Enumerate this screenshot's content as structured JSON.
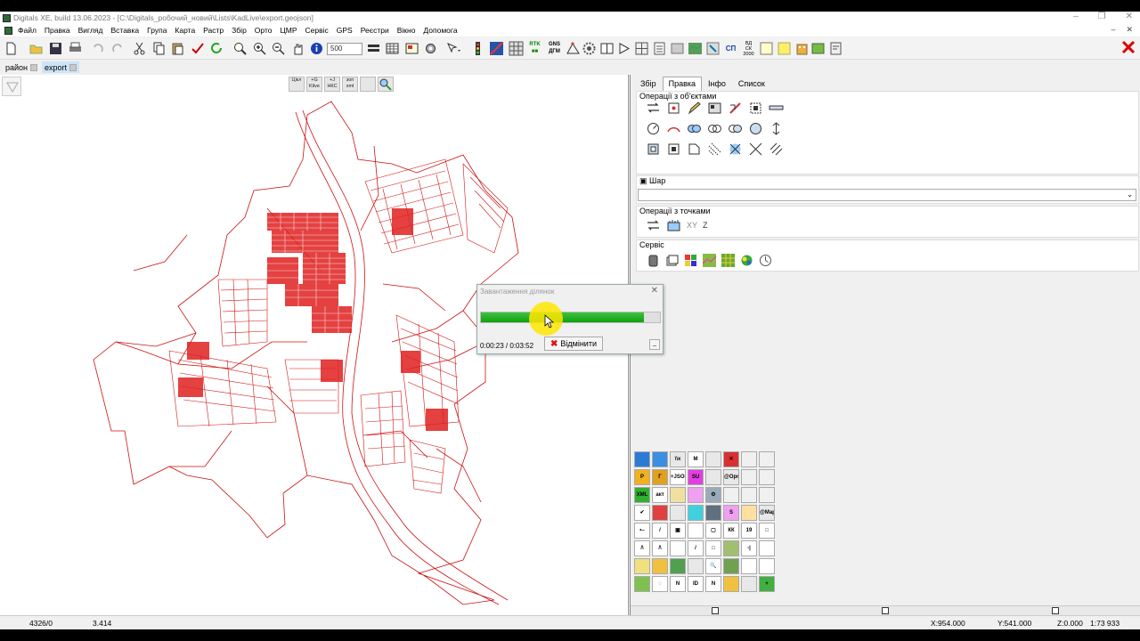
{
  "app": {
    "title": "Digitals XE, build 13.06.2023 - [C:\\Digitals_робочий_новий\\Lists\\KadLive\\export.geojson]"
  },
  "menu": [
    "Файл",
    "Правка",
    "Вигляд",
    "Вставка",
    "Група",
    "Карта",
    "Растр",
    "Збір",
    "Орто",
    "ЦМР",
    "Сервіс",
    "GPS",
    "Реєстри",
    "Вікно",
    "Допомога"
  ],
  "toolbar": {
    "scale_value": "500"
  },
  "doc_tabs": [
    "район",
    "export"
  ],
  "map_tools": [
    "Цікл",
    "+G Klive",
    "+J НКС",
    "зоп xml",
    "",
    ""
  ],
  "panel": {
    "tabs": [
      "Збір",
      "Правка",
      "Інфо",
      "Список"
    ],
    "active_tab": "Правка",
    "sections": {
      "objects": "Операції з об'єктами",
      "layer": "Шар",
      "points": "Операції з точками",
      "service": "Сервіс"
    },
    "points_labels": [
      "XY",
      "Z"
    ]
  },
  "palette": [
    {
      "label": "",
      "color": "#2b7bd6"
    },
    {
      "label": "",
      "color": "#3a8fe0"
    },
    {
      "label": "\\\\x",
      "color": "#e8e8e8"
    },
    {
      "label": "M",
      "color": "#ffffff"
    },
    {
      "label": "",
      "color": "#e8e8e8"
    },
    {
      "label": "✕",
      "color": "#d93030"
    },
    {
      "label": "",
      "color": "#f0f0f0"
    },
    {
      "label": "",
      "color": "#f0f0f0"
    },
    {
      "label": "P",
      "color": "#f0b020"
    },
    {
      "label": "Г",
      "color": "#e0a020"
    },
    {
      "label": "+JSON",
      "color": "#ffffff"
    },
    {
      "label": "SU",
      "color": "#e040e0"
    },
    {
      "label": "",
      "color": "#e8e8e8"
    },
    {
      "label": "@Opr",
      "color": "#e8e8e8"
    },
    {
      "label": "",
      "color": "#f0f0f0"
    },
    {
      "label": "",
      "color": "#f0f0f0"
    },
    {
      "label": "XML",
      "color": "#30b030"
    },
    {
      "label": "акт",
      "color": "#ffffff"
    },
    {
      "label": "",
      "color": "#f0e0a0"
    },
    {
      "label": "",
      "color": "#f0a0f0"
    },
    {
      "label": "⚙",
      "color": "#9ab"
    },
    {
      "label": "",
      "color": "#f0f0f0"
    },
    {
      "label": "",
      "color": "#f0f0f0"
    },
    {
      "label": "",
      "color": "#f0f0f0"
    },
    {
      "label": "✔",
      "color": "#ffffff"
    },
    {
      "label": "",
      "color": "#e04040"
    },
    {
      "label": "",
      "color": "#e8e8e8"
    },
    {
      "label": "",
      "color": "#40d0e0"
    },
    {
      "label": "",
      "color": "#607080"
    },
    {
      "label": "S",
      "color": "#f0a0f0"
    },
    {
      "label": "",
      "color": "#ffe0a0"
    },
    {
      "label": "@Map",
      "color": "#e8e8e8"
    },
    {
      "label": "•–",
      "color": "#ffffff"
    },
    {
      "label": "/",
      "color": "#ffffff"
    },
    {
      "label": "▣",
      "color": "#ffffff"
    },
    {
      "label": "",
      "color": "#ffffff"
    },
    {
      "label": "▢",
      "color": "#ffffff"
    },
    {
      "label": "КК",
      "color": "#ffffff"
    },
    {
      "label": "19",
      "color": "#ffffff"
    },
    {
      "label": "□",
      "color": "#ffffff"
    },
    {
      "label": "/\\",
      "color": "#ffffff"
    },
    {
      "label": "/\\",
      "color": "#ffffff"
    },
    {
      "label": "",
      "color": "#ffffff"
    },
    {
      "label": "/",
      "color": "#ffffff"
    },
    {
      "label": "□",
      "color": "#ffffff"
    },
    {
      "label": "",
      "color": "#a0c070"
    },
    {
      "label": "-|",
      "color": "#ffffff"
    },
    {
      "label": "",
      "color": "#ffffff"
    },
    {
      "label": "",
      "color": "#f0e080"
    },
    {
      "label": "",
      "color": "#f0c040"
    },
    {
      "label": "",
      "color": "#50a050"
    },
    {
      "label": "",
      "color": "#e8e8e8"
    },
    {
      "label": "🔍",
      "color": "#ffffff"
    },
    {
      "label": "",
      "color": "#70a050"
    },
    {
      "label": "",
      "color": "#ffffff"
    },
    {
      "label": "",
      "color": "#ffffff"
    },
    {
      "label": "",
      "color": "#80c050"
    },
    {
      "label": "◌",
      "color": "#ffffff"
    },
    {
      "label": "N",
      "color": "#ffffff"
    },
    {
      "label": "ID",
      "color": "#ffffff"
    },
    {
      "label": "N",
      "color": "#ffffff"
    },
    {
      "label": "",
      "color": "#f0c040"
    },
    {
      "label": "",
      "color": "#e8e8e8"
    },
    {
      "label": "+",
      "color": "#40b040"
    }
  ],
  "status": {
    "count": "4326/0",
    "value": "3.414",
    "x": "X:954.000",
    "y": "Y:541.000",
    "z": "Z:0.000",
    "scale": "1:73 933"
  },
  "dialog": {
    "title": "Завантаження ділянок",
    "progress_fraction": 0.91,
    "time": "0:00:23 / 0:03:52",
    "cancel_label": "Відмінити"
  }
}
